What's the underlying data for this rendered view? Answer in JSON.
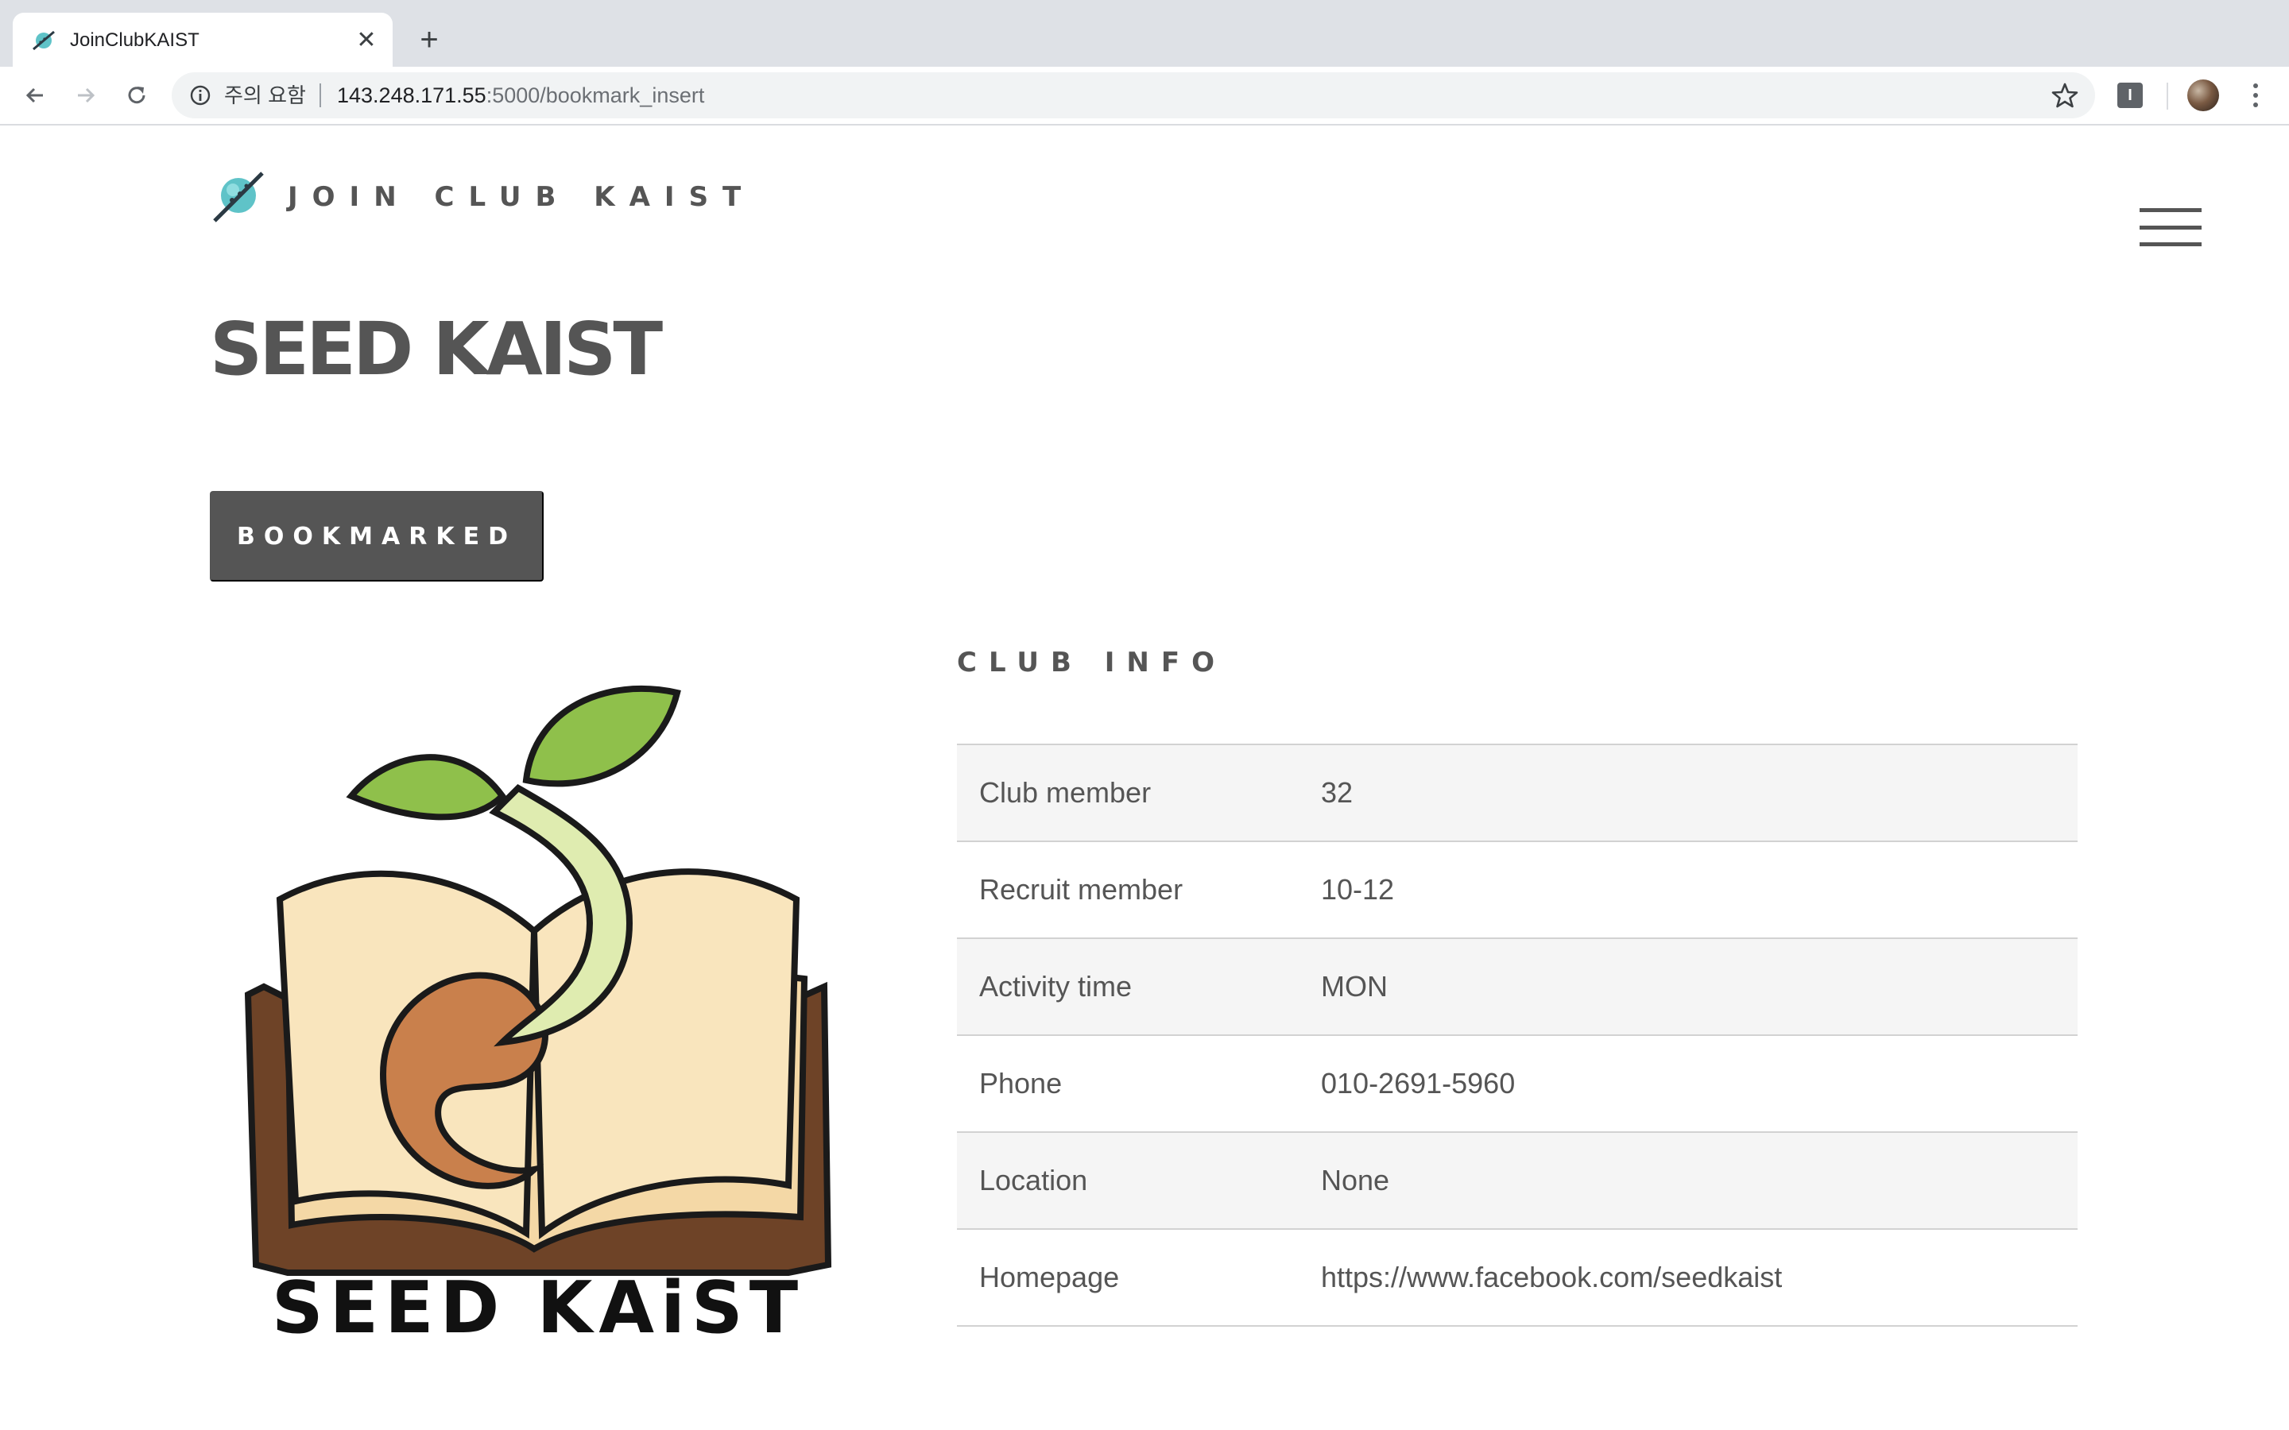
{
  "browser": {
    "tab_title": "JoinClubKAIST",
    "tab_close": "✕",
    "new_tab": "+",
    "security_label": "주의 요함",
    "url_host": "143.248.171.55",
    "url_path": ":5000/bookmark_insert",
    "extension_label": "I"
  },
  "site": {
    "brand_name": "JOIN CLUB KAIST"
  },
  "club": {
    "name": "SEED KAIST",
    "bookmark_label": "BOOKMARKED",
    "logo_text": "SEED KAiST",
    "info_heading": "CLUB INFO",
    "info": [
      {
        "label": "Club member",
        "value": "32"
      },
      {
        "label": "Recruit member",
        "value": "10-12"
      },
      {
        "label": "Activity time",
        "value": "MON"
      },
      {
        "label": "Phone",
        "value": "010-2691-5960"
      },
      {
        "label": "Location",
        "value": "None"
      },
      {
        "label": "Homepage",
        "value": "https://www.facebook.com/seedkaist"
      }
    ]
  },
  "colors": {
    "text_gray": "#555555",
    "button_bg": "#555555",
    "row_alt": "#f5f5f5",
    "chrome_bg": "#dee1e6"
  },
  "icons": [
    "planet-icon",
    "close-icon",
    "plus-icon",
    "back-arrow-icon",
    "forward-arrow-icon",
    "reload-icon",
    "info-icon",
    "star-icon",
    "extension-icon",
    "avatar",
    "more-vert-icon",
    "hamburger-menu-icon"
  ]
}
